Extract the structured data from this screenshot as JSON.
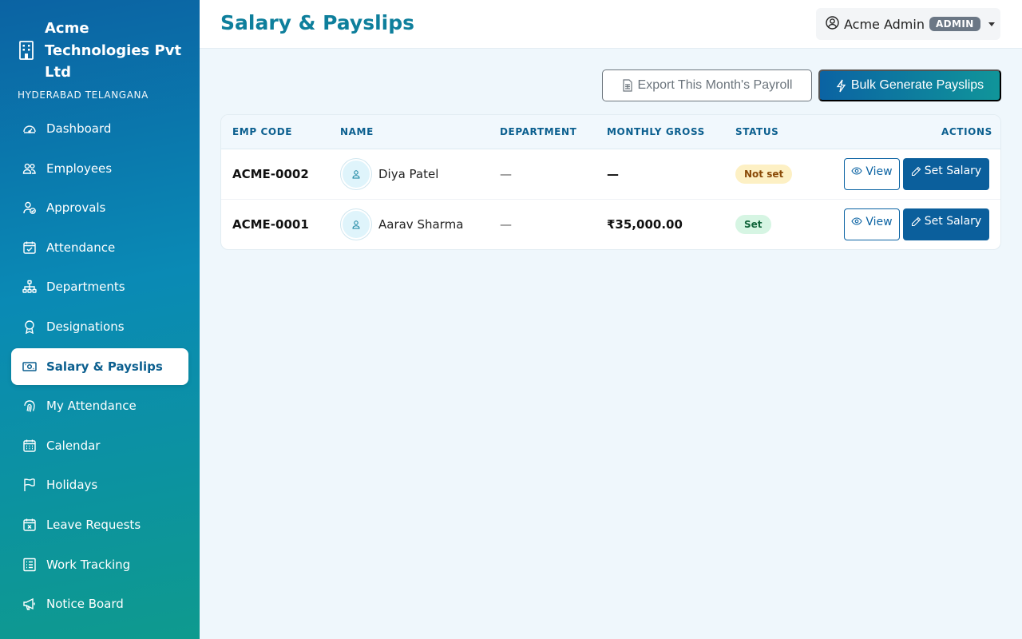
{
  "company": {
    "name": "Acme Technologies Pvt Ltd",
    "location": "HYDERABAD TELANGANA"
  },
  "sidebar": {
    "items": [
      {
        "label": "Dashboard",
        "icon": "speedometer-icon"
      },
      {
        "label": "Employees",
        "icon": "people-icon"
      },
      {
        "label": "Approvals",
        "icon": "person-check-icon"
      },
      {
        "label": "Attendance",
        "icon": "calendar-check-icon"
      },
      {
        "label": "Departments",
        "icon": "diagram-icon"
      },
      {
        "label": "Designations",
        "icon": "award-icon"
      },
      {
        "label": "Salary & Payslips",
        "icon": "cash-icon",
        "active": true
      },
      {
        "label": "My Attendance",
        "icon": "fingerprint-icon"
      },
      {
        "label": "Calendar",
        "icon": "calendar-icon"
      },
      {
        "label": "Holidays",
        "icon": "flag-icon"
      },
      {
        "label": "Leave Requests",
        "icon": "calendar-x-icon"
      },
      {
        "label": "Work Tracking",
        "icon": "list-task-icon"
      },
      {
        "label": "Notice Board",
        "icon": "megaphone-icon"
      }
    ]
  },
  "header": {
    "title": "Salary & Payslips",
    "user_name": "Acme Admin",
    "role_badge": "ADMIN"
  },
  "actions": {
    "export_label": "Export This Month's Payroll",
    "bulk_label": "Bulk Generate Payslips"
  },
  "table": {
    "columns": [
      "EMP CODE",
      "NAME",
      "DEPARTMENT",
      "MONTHLY GROSS",
      "STATUS",
      "ACTIONS"
    ],
    "rows": [
      {
        "emp_code": "ACME-0002",
        "name": "Diya Patel",
        "department": "—",
        "gross": "—",
        "status": "Not set",
        "view_label": "View",
        "set_label": "Set Salary"
      },
      {
        "emp_code": "ACME-0001",
        "name": "Aarav Sharma",
        "department": "—",
        "gross": "₹35,000.00",
        "status": "Set",
        "view_label": "View",
        "set_label": "Set Salary"
      }
    ]
  },
  "colors": {
    "accent": "#0b63a3",
    "title": "#0e7f9c",
    "status_not_set_bg": "#fdf0c4",
    "status_set_bg": "#d6f5e3"
  }
}
